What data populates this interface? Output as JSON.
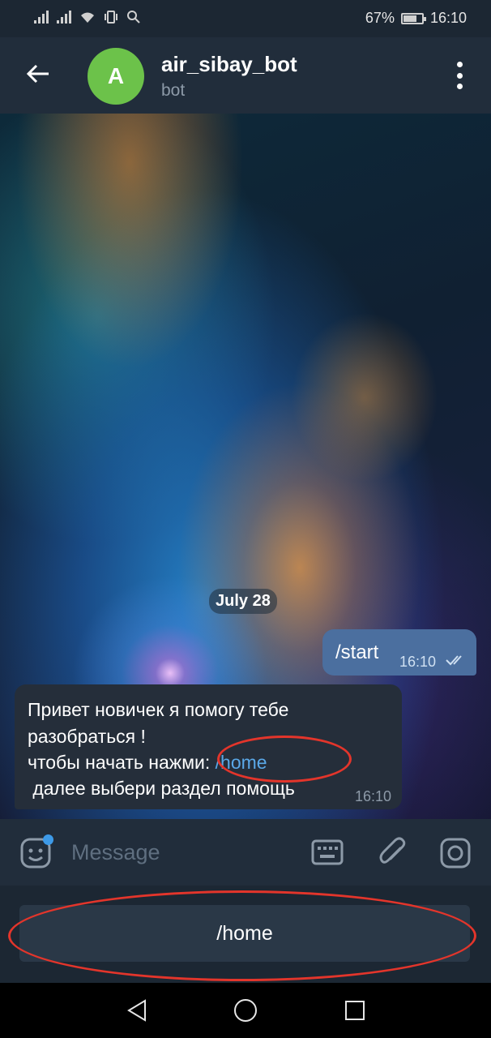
{
  "status_bar": {
    "battery": "67%",
    "time": "16:10"
  },
  "header": {
    "avatar_letter": "A",
    "title": "air_sibay_bot",
    "subtitle": "bot"
  },
  "chat": {
    "date_chip": "July 28",
    "outgoing": {
      "text": "/start",
      "time": "16:10"
    },
    "incoming": {
      "line1": "Привет новичек я помогу тебе",
      "line2": "разобраться !",
      "line3_prefix": "чтобы начать нажми: ",
      "line3_link": "/home",
      "line4": " далее выбери раздел помощь",
      "time": "16:10"
    }
  },
  "input_bar": {
    "placeholder": "Message"
  },
  "bot_keyboard": {
    "buttons": [
      "/home"
    ]
  },
  "colors": {
    "header": "#212d3b",
    "outgoing_bubble": "#4b6f9f",
    "incoming_bubble": "#252e3a",
    "link": "#5aa8e8",
    "annotation": "#e3352b"
  },
  "icons": [
    "back-arrow-icon",
    "more-vert-icon",
    "emoji-icon",
    "keyboard-icon",
    "attach-icon",
    "camera-icon",
    "double-check-icon"
  ]
}
